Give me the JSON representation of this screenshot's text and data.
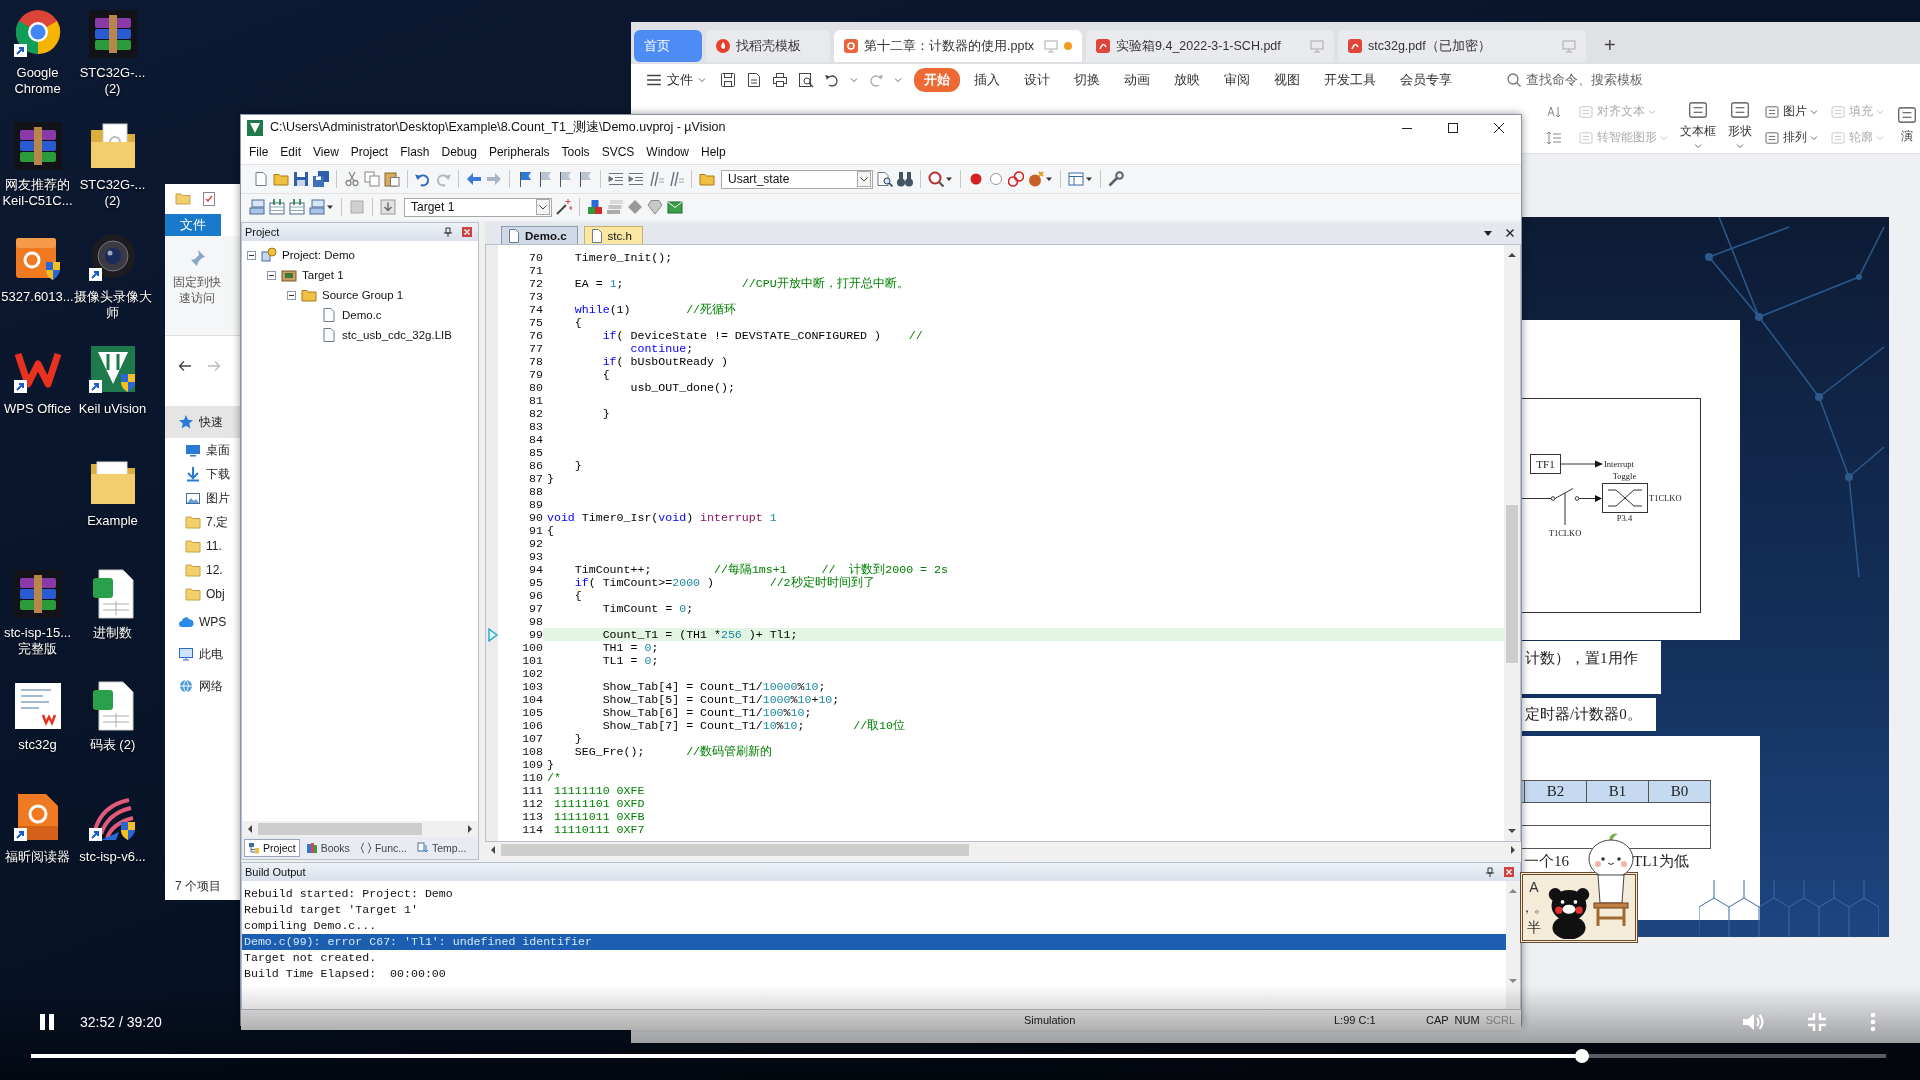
{
  "desktop": {
    "icons": [
      {
        "label": "Google\nChrome",
        "kind": "chrome",
        "shortcut": true
      },
      {
        "label": "STC32G-...\n(2)",
        "kind": "archive",
        "shortcut": false
      },
      {
        "label": "网友推荐的\nKeil-C51C...",
        "kind": "archive",
        "shortcut": false
      },
      {
        "label": "STC32G-...\n(2)",
        "kind": "folder-doc",
        "shortcut": false
      },
      {
        "label": "5327.6013...",
        "kind": "pdf-setup",
        "shortcut": false
      },
      {
        "label": "摄像头录像大师",
        "kind": "camera",
        "shortcut": true
      },
      {
        "label": "WPS Office",
        "kind": "wps",
        "shortcut": true
      },
      {
        "label": "Keil uVision",
        "kind": "keil",
        "shortcut": true
      },
      {
        "label": "Example",
        "kind": "folder",
        "shortcut": false
      },
      {
        "label": "stc-isp-15...\n完整版",
        "kind": "archive",
        "shortcut": false
      },
      {
        "label": "进制数",
        "kind": "sheet",
        "shortcut": false
      },
      {
        "label": "stc32g",
        "kind": "doc",
        "shortcut": false
      },
      {
        "label": "码表 (2)",
        "kind": "sheet",
        "shortcut": false
      },
      {
        "label": "福昕阅读器",
        "kind": "pdf-reader",
        "shortcut": true
      },
      {
        "label": "stc-isp-v6...",
        "kind": "isp",
        "shortcut": true
      }
    ]
  },
  "wps": {
    "tabs": [
      {
        "label": "首页",
        "kind": "home",
        "selected": false,
        "modified": false
      },
      {
        "label": "找稻壳模板",
        "kind": "template",
        "selected": false,
        "modified": false
      },
      {
        "label": "第十二章：计数器的使用.pptx",
        "kind": "pptx",
        "selected": true,
        "modified": true
      },
      {
        "label": "实验箱9.4_2022-3-1-SCH.pdf",
        "kind": "pdf",
        "selected": false,
        "modified": false
      },
      {
        "label": "stc32g.pdf（已加密）",
        "kind": "pdf",
        "selected": false,
        "modified": false
      }
    ],
    "new_tab": "+",
    "file_menu": "文件",
    "menu": [
      {
        "label": "开始",
        "selected": true
      },
      {
        "label": "插入",
        "selected": false
      },
      {
        "label": "设计",
        "selected": false
      },
      {
        "label": "切换",
        "selected": false
      },
      {
        "label": "动画",
        "selected": false
      },
      {
        "label": "放映",
        "selected": false
      },
      {
        "label": "审阅",
        "selected": false
      },
      {
        "label": "视图",
        "selected": false
      },
      {
        "label": "开发工具",
        "selected": false
      },
      {
        "label": "会员专享",
        "selected": false
      }
    ],
    "search": {
      "placeholder": "查找命令、搜索模板"
    },
    "ribbon": [
      {
        "label": "对齐文本",
        "kind": "small",
        "disabled": true,
        "dropdown": true
      },
      {
        "label": "转智能图形",
        "kind": "small",
        "disabled": true,
        "dropdown": true
      },
      {
        "label": "文本框",
        "kind": "large",
        "disabled": false,
        "dropdown": true
      },
      {
        "label": "形状",
        "kind": "large",
        "disabled": false,
        "dropdown": true
      },
      {
        "label": "图片",
        "kind": "small",
        "disabled": false,
        "dropdown": true
      },
      {
        "label": "排列",
        "kind": "small",
        "disabled": false,
        "dropdown": true
      },
      {
        "label": "填充",
        "kind": "small",
        "disabled": true,
        "dropdown": true
      },
      {
        "label": "轮廓",
        "kind": "small",
        "disabled": true,
        "dropdown": true
      },
      {
        "label": "演",
        "kind": "large",
        "disabled": false,
        "dropdown": false
      }
    ],
    "slide": {
      "diagram": {
        "flag": "TF1",
        "interrupt": "Interrupt",
        "toggle": "Toggle",
        "output": "T1CLKO",
        "pin": "P3.4",
        "switch_label": "T1CLKO"
      },
      "text_boxes": [
        "计数），置1用作",
        "定时器/计数器0。"
      ],
      "table": {
        "columns": [
          "B2",
          "B1",
          "B0"
        ]
      },
      "caption_parts": [
        "一个16",
        "TL1为低"
      ]
    }
  },
  "explorer": {
    "ribbon_tab": "文件",
    "pin_button": "固定到快速访问",
    "nav": [
      {
        "label": "快速",
        "kind": "star",
        "selected": true,
        "children": [
          {
            "label": "桌面",
            "kind": "desktop",
            "selected": false
          },
          {
            "label": "下载",
            "kind": "download",
            "selected": false
          },
          {
            "label": "图片",
            "kind": "pictures",
            "selected": false
          },
          {
            "label": "7.定",
            "kind": "folder",
            "selected": false
          },
          {
            "label": "11.",
            "kind": "folder",
            "selected": false
          },
          {
            "label": "12.",
            "kind": "folder",
            "selected": false
          },
          {
            "label": "Obj",
            "kind": "folder",
            "selected": false
          }
        ]
      },
      {
        "label": "WPS",
        "kind": "cloud",
        "selected": false
      },
      {
        "label": "此电",
        "kind": "pc",
        "selected": false
      },
      {
        "label": "网络",
        "kind": "network",
        "selected": false
      }
    ],
    "status": "7 个项目"
  },
  "keil": {
    "title": "C:\\Users\\Administrator\\Desktop\\Example\\8.Count_T1_测速\\Demo.uvproj - µVision",
    "menu": [
      "File",
      "Edit",
      "View",
      "Project",
      "Flash",
      "Debug",
      "Peripherals",
      "Tools",
      "SVCS",
      "Window",
      "Help"
    ],
    "find_combo": {
      "value": "Usart_state"
    },
    "target_combo": {
      "value": "Target 1"
    },
    "project": {
      "title": "Project",
      "tree": [
        {
          "label": "Project: Demo",
          "kind": "project",
          "expanded": true,
          "children": [
            {
              "label": "Target 1",
              "kind": "target",
              "expanded": true,
              "children": [
                {
                  "label": "Source Group 1",
                  "kind": "group",
                  "expanded": true,
                  "children": [
                    {
                      "label": "Demo.c",
                      "kind": "file"
                    },
                    {
                      "label": "stc_usb_cdc_32g.LIB",
                      "kind": "file"
                    }
                  ]
                }
              ]
            }
          ]
        }
      ],
      "tabs": [
        {
          "label": "Project",
          "kind": "project",
          "selected": true
        },
        {
          "label": "Books",
          "kind": "books",
          "selected": false
        },
        {
          "label": "Func...",
          "kind": "functions",
          "selected": false
        },
        {
          "label": "Temp...",
          "kind": "templates",
          "selected": false
        }
      ]
    },
    "editor": {
      "tabs": [
        {
          "label": "Demo.c",
          "selected": true
        },
        {
          "label": "stc.h",
          "selected": false
        }
      ],
      "lines": [
        {
          "number": "70",
          "current": false,
          "tokens": [
            {
              "kind": "plain",
              "text": "    Timer0_Init();"
            }
          ]
        },
        {
          "number": "71",
          "current": false
        },
        {
          "number": "72",
          "current": false,
          "tokens": [
            {
              "kind": "plain",
              "text": "    EA = "
            },
            {
              "kind": "number",
              "text": "1"
            },
            {
              "kind": "plain",
              "text": ";                 "
            },
            {
              "kind": "comment",
              "text": "//CPU开放中断，打开总中断。"
            }
          ]
        },
        {
          "number": "73",
          "current": false
        },
        {
          "number": "74",
          "current": false,
          "tokens": [
            {
              "kind": "keyword",
              "text": "    while"
            },
            {
              "kind": "plain",
              "text": "(1)        "
            },
            {
              "kind": "comment",
              "text": "//死循环"
            }
          ]
        },
        {
          "number": "75",
          "current": false,
          "tokens": [
            {
              "kind": "plain",
              "text": "    {"
            }
          ]
        },
        {
          "number": "76",
          "current": false,
          "tokens": [
            {
              "kind": "keyword",
              "text": "        if"
            },
            {
              "kind": "plain",
              "text": "( DeviceState != DEVSTATE_CONFIGURED )    "
            },
            {
              "kind": "comment",
              "text": "//"
            }
          ]
        },
        {
          "number": "77",
          "current": false,
          "tokens": [
            {
              "kind": "keyword",
              "text": "            continue"
            },
            {
              "kind": "plain",
              "text": ";"
            }
          ]
        },
        {
          "number": "78",
          "current": false,
          "tokens": [
            {
              "kind": "keyword",
              "text": "        if"
            },
            {
              "kind": "plain",
              "text": "( bUsbOutReady )"
            }
          ]
        },
        {
          "number": "79",
          "current": false,
          "tokens": [
            {
              "kind": "plain",
              "text": "        {"
            }
          ]
        },
        {
          "number": "80",
          "current": false,
          "tokens": [
            {
              "kind": "plain",
              "text": "            usb_OUT_done();"
            }
          ]
        },
        {
          "number": "81",
          "current": false
        },
        {
          "number": "82",
          "current": false,
          "tokens": [
            {
              "kind": "plain",
              "text": "        }"
            }
          ]
        },
        {
          "number": "83",
          "current": false
        },
        {
          "number": "84",
          "current": false
        },
        {
          "number": "85",
          "current": false
        },
        {
          "number": "86",
          "current": false,
          "tokens": [
            {
              "kind": "plain",
              "text": "    }"
            }
          ]
        },
        {
          "number": "87",
          "current": false,
          "tokens": [
            {
              "kind": "plain",
              "text": "}"
            }
          ]
        },
        {
          "number": "88",
          "current": false
        },
        {
          "number": "89",
          "current": false
        },
        {
          "number": "90",
          "current": false,
          "tokens": [
            {
              "kind": "keyword",
              "text": "void"
            },
            {
              "kind": "plain",
              "text": " Timer0_Isr("
            },
            {
              "kind": "keyword",
              "text": "void"
            },
            {
              "kind": "plain",
              "text": ") "
            },
            {
              "kind": "keyword2",
              "text": "interrupt"
            },
            {
              "kind": "number",
              "text": " 1"
            }
          ]
        },
        {
          "number": "91",
          "current": false,
          "tokens": [
            {
              "kind": "plain",
              "text": "{"
            }
          ]
        },
        {
          "number": "92",
          "current": false
        },
        {
          "number": "93",
          "current": false
        },
        {
          "number": "94",
          "current": false,
          "tokens": [
            {
              "kind": "plain",
              "text": "    TimCount++;         "
            },
            {
              "kind": "comment",
              "text": "//每隔1ms+1     //  计数到2000 = 2s"
            }
          ]
        },
        {
          "number": "95",
          "current": false,
          "tokens": [
            {
              "kind": "keyword",
              "text": "    if"
            },
            {
              "kind": "plain",
              "text": "( TimCount>="
            },
            {
              "kind": "number",
              "text": "2000"
            },
            {
              "kind": "plain",
              "text": " )        "
            },
            {
              "kind": "comment",
              "text": "//2秒定时时间到了"
            }
          ]
        },
        {
          "number": "96",
          "current": false,
          "tokens": [
            {
              "kind": "plain",
              "text": "    {"
            }
          ]
        },
        {
          "number": "97",
          "current": false,
          "tokens": [
            {
              "kind": "plain",
              "text": "        TimCount = "
            },
            {
              "kind": "number",
              "text": "0"
            },
            {
              "kind": "plain",
              "text": ";"
            }
          ]
        },
        {
          "number": "98",
          "current": false
        },
        {
          "number": "99",
          "current": true,
          "tokens": [
            {
              "kind": "plain",
              "text": "        Count_T1 = (TH1 *"
            },
            {
              "kind": "number",
              "text": "256"
            },
            {
              "kind": "plain",
              "text": " )+ Tl1;"
            }
          ]
        },
        {
          "number": "100",
          "current": false,
          "tokens": [
            {
              "kind": "plain",
              "text": "        TH1 = "
            },
            {
              "kind": "number",
              "text": "0"
            },
            {
              "kind": "plain",
              "text": ";"
            }
          ]
        },
        {
          "number": "101",
          "current": false,
          "tokens": [
            {
              "kind": "plain",
              "text": "        TL1 = "
            },
            {
              "kind": "number",
              "text": "0"
            },
            {
              "kind": "plain",
              "text": ";"
            }
          ]
        },
        {
          "number": "102",
          "current": false
        },
        {
          "number": "103",
          "current": false,
          "tokens": [
            {
              "kind": "plain",
              "text": "        Show_Tab[4] = Count_T1/"
            },
            {
              "kind": "number",
              "text": "10000"
            },
            {
              "kind": "plain",
              "text": "%"
            },
            {
              "kind": "number",
              "text": "10"
            },
            {
              "kind": "plain",
              "text": ";"
            }
          ]
        },
        {
          "number": "104",
          "current": false,
          "tokens": [
            {
              "kind": "plain",
              "text": "        Show_Tab[5] = Count_T1/"
            },
            {
              "kind": "number",
              "text": "1000"
            },
            {
              "kind": "plain",
              "text": "%"
            },
            {
              "kind": "number",
              "text": "10"
            },
            {
              "kind": "plain",
              "text": "+"
            },
            {
              "kind": "number",
              "text": "10"
            },
            {
              "kind": "plain",
              "text": ";"
            }
          ]
        },
        {
          "number": "105",
          "current": false,
          "tokens": [
            {
              "kind": "plain",
              "text": "        Show_Tab[6] = Count_T1/"
            },
            {
              "kind": "number",
              "text": "100"
            },
            {
              "kind": "plain",
              "text": "%"
            },
            {
              "kind": "number",
              "text": "10"
            },
            {
              "kind": "plain",
              "text": ";"
            }
          ]
        },
        {
          "number": "106",
          "current": false,
          "tokens": [
            {
              "kind": "plain",
              "text": "        Show_Tab[7] = Count_T1/"
            },
            {
              "kind": "number",
              "text": "10"
            },
            {
              "kind": "plain",
              "text": "%"
            },
            {
              "kind": "number",
              "text": "10"
            },
            {
              "kind": "plain",
              "text": ";       "
            },
            {
              "kind": "comment",
              "text": "//取10位"
            }
          ]
        },
        {
          "number": "107",
          "current": false,
          "tokens": [
            {
              "kind": "plain",
              "text": "    }"
            }
          ]
        },
        {
          "number": "108",
          "current": false,
          "tokens": [
            {
              "kind": "plain",
              "text": "    SEG_Fre();      "
            },
            {
              "kind": "comment",
              "text": "//数码管刷新的"
            }
          ]
        },
        {
          "number": "109",
          "current": false,
          "tokens": [
            {
              "kind": "plain",
              "text": "}"
            }
          ]
        },
        {
          "number": "110",
          "current": false,
          "tokens": [
            {
              "kind": "comment",
              "text": "/*"
            }
          ]
        },
        {
          "number": "111",
          "current": false,
          "tokens": [
            {
              "kind": "comment",
              "text": " 11111110 0XFE"
            }
          ]
        },
        {
          "number": "112",
          "current": false,
          "tokens": [
            {
              "kind": "comment",
              "text": " 11111101 0XFD"
            }
          ]
        },
        {
          "number": "113",
          "current": false,
          "tokens": [
            {
              "kind": "comment",
              "text": " 11111011 0XFB"
            }
          ]
        },
        {
          "number": "114",
          "current": false,
          "tokens": [
            {
              "kind": "comment",
              "text": " 11110111 0XF7"
            }
          ]
        }
      ]
    },
    "output": {
      "title": "Build Output",
      "lines": [
        {
          "text": "Rebuild started: Project: Demo",
          "selected": false
        },
        {
          "text": "Rebuild target 'Target 1'",
          "selected": false
        },
        {
          "text": "compiling Demo.c...",
          "selected": false
        },
        {
          "text": "Demo.c(99): error C67: 'Tl1': undefined identifier",
          "selected": true
        },
        {
          "text": "Target not created.",
          "selected": false
        },
        {
          "text": "Build Time Elapsed:  00:00:00",
          "selected": false
        }
      ]
    },
    "status": {
      "mode": "Simulation",
      "position": "L:99 C:1",
      "indicators": [
        {
          "label": "CAP",
          "on": true
        },
        {
          "label": "NUM",
          "on": true
        },
        {
          "label": "SCRL",
          "on": false
        }
      ]
    }
  },
  "ime": {
    "labels": [
      "A",
      "，。",
      "半"
    ]
  },
  "player": {
    "playing": true,
    "time": "32:52 / 39:20",
    "progress": {
      "level": 0.836
    }
  }
}
